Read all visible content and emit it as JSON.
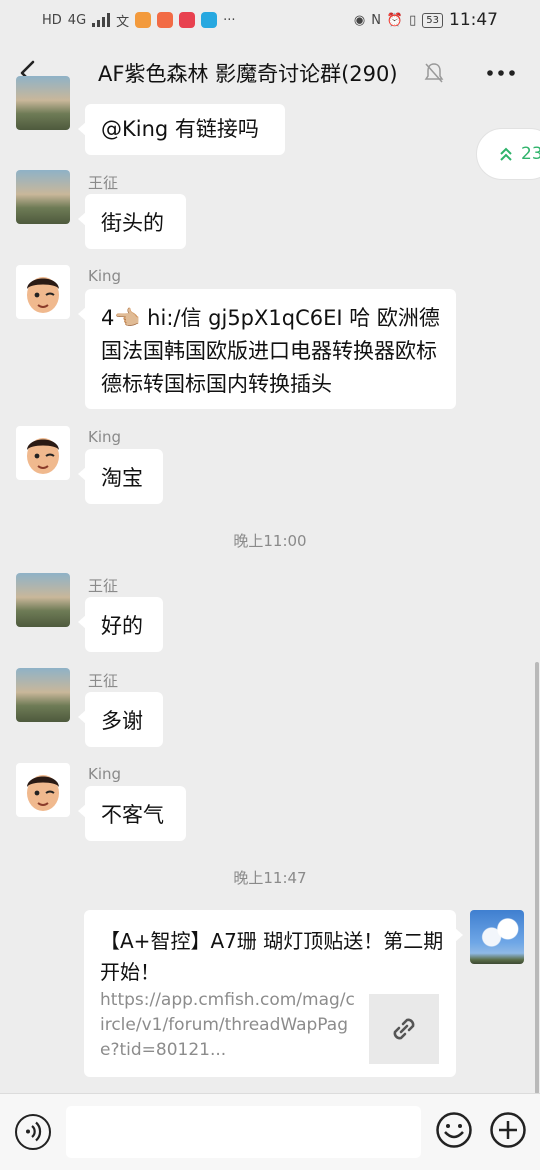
{
  "status_bar": {
    "network": "4G",
    "battery": "53",
    "time": "11:47",
    "icons": [
      "hd-icon",
      "signal-icon",
      "translate-icon",
      "app-icon-orange",
      "app-icon-red",
      "app-icon-pink",
      "app-icon-teal",
      "more-dots-icon",
      "eye-icon",
      "nfc-icon",
      "alarm-icon",
      "vibrate-icon",
      "battery-icon"
    ]
  },
  "header": {
    "title": "AF紫色森林 影魔奇讨论群(290)"
  },
  "jump_pill": {
    "count": "23"
  },
  "messages": [
    {
      "sender": "",
      "text": "@King 有链接吗"
    },
    {
      "sender": "王征",
      "text": "街头的"
    },
    {
      "sender": "King",
      "text": "4👈🏼 hi:/信 gj5pX1qC6EI 哈 欧洲德国法国韩国欧版进口电器转换器欧标德标转国标国内转换插头"
    },
    {
      "sender": "King",
      "text": "淘宝"
    },
    {
      "sender": "王征",
      "text": "好的"
    },
    {
      "sender": "王征",
      "text": "多谢"
    },
    {
      "sender": "King",
      "text": "不客气"
    }
  ],
  "timestamps": [
    "晚上11:00",
    "晚上11:47"
  ],
  "link_card": {
    "title": "【A+智控】A7珊 瑚灯顶贴送！第二期开始！",
    "url": "https://app.cmfish.com/mag/circle/v1/forum/threadWapPage?tid=80121..."
  },
  "colors": {
    "background": "#ededed",
    "bubble": "#ffffff",
    "accent_green": "#2fb36b",
    "meta_gray": "#8a8a8a"
  }
}
